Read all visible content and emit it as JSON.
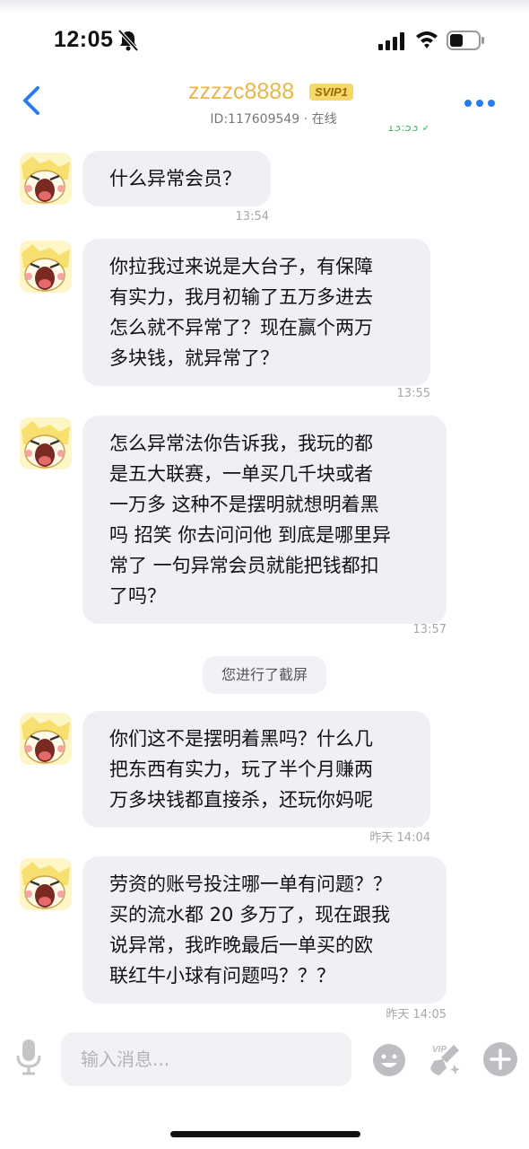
{
  "status_bar": {
    "time": "12:05"
  },
  "header": {
    "contact_name": "zzzzc8888",
    "badge": "SVIP1",
    "id_text": "ID:117609549",
    "separator": "·",
    "online_status": "在线"
  },
  "messages": [
    {
      "text": [
        "什么异常会员？"
      ],
      "time": "13:54"
    },
    {
      "text": [
        "你拉我过来说是大台子，有保障",
        "有实力，我月初输了五万多进去",
        "怎么就不异常了？现在赢个两万",
        "多块钱，就异常了？"
      ],
      "time": "13:55"
    },
    {
      "text": [
        "怎么异常法你告诉我，我玩的都",
        "是五大联赛，一单买几千块或者",
        "一万多 这种不是摆明就想明着黑",
        "吗 招笑 你去问问他 到底是哪里异",
        "常了 一句异常会员就能把钱都扣",
        "了吗？"
      ],
      "time": "13:57"
    },
    {
      "text": [
        "你们这不是摆明着黑吗？什么几",
        "把东西有实力，玩了半个月赚两",
        "万多块钱都直接杀，还玩你妈呢"
      ],
      "time": "昨天 14:04"
    },
    {
      "text": [
        "劳资的账号投注哪一单有问题？？",
        "买的流水都 20 多万了，现在跟我",
        "说异常，我昨晚最后一单买的欧",
        "联红牛小球有问题吗？？？"
      ],
      "time": "昨天 14:05"
    }
  ],
  "system_notice": "您进行了截屏",
  "input": {
    "placeholder": "输入消息..."
  },
  "colors": {
    "accent": "#2b7bf0",
    "name": "#e8b64a",
    "bubble": "#eef0f5"
  }
}
